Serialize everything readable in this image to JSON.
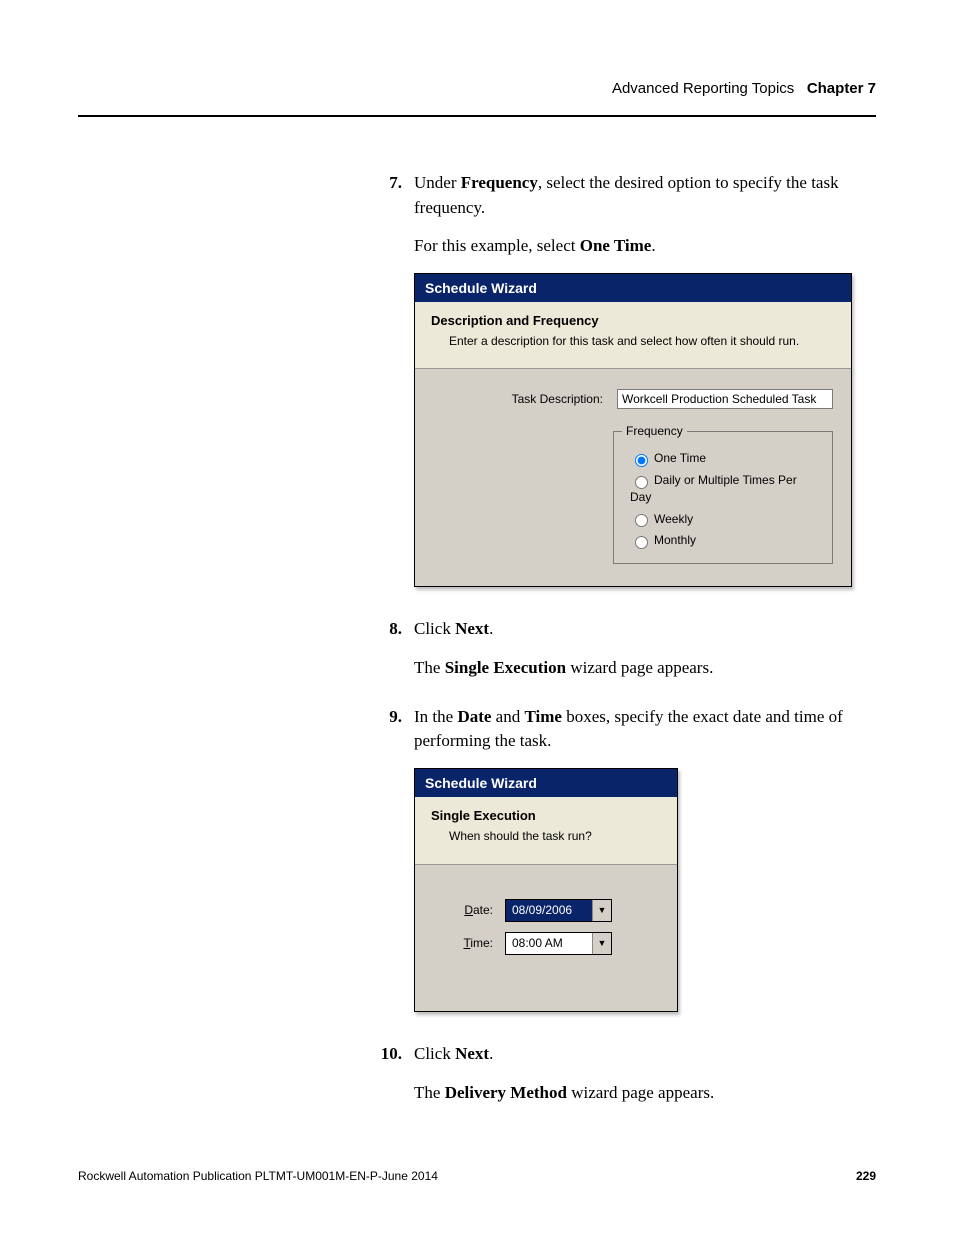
{
  "header": {
    "section": "Advanced Reporting Topics",
    "chapter": "Chapter 7"
  },
  "steps": {
    "s7": {
      "num": "7.",
      "text_pre": "Under ",
      "bold1": "Frequency",
      "text_mid": ", select the desired option to specify the task frequency.",
      "line2_pre": "For this example, select ",
      "line2_bold": "One Time",
      "line2_post": "."
    },
    "s8": {
      "num": "8.",
      "text_pre": "Click ",
      "bold1": "Next",
      "text_post": ".",
      "after_pre": "The ",
      "after_bold": "Single Execution",
      "after_post": " wizard page appears."
    },
    "s9": {
      "num": "9.",
      "text_pre": "In the ",
      "bold1": "Date",
      "text_mid": " and ",
      "bold2": "Time",
      "text_post": " boxes, specify the exact date and time of performing the task."
    },
    "s10": {
      "num": "10.",
      "text_pre": "Click ",
      "bold1": "Next",
      "text_post": ".",
      "after_pre": "The ",
      "after_bold": "Delivery Method",
      "after_post": " wizard page appears."
    }
  },
  "wizard1": {
    "title": "Schedule Wizard",
    "head_title": "Description and Frequency",
    "head_sub": "Enter a description for this task and select how often it should run.",
    "task_label": "Task Description:",
    "task_value": "Workcell Production Scheduled Task",
    "freq_legend": "Frequency",
    "opt1": "One Time",
    "opt2": "Daily or Multiple Times Per Day",
    "opt3": "Weekly",
    "opt4": "Monthly"
  },
  "wizard2": {
    "title": "Schedule Wizard",
    "head_title": "Single Execution",
    "head_sub": "When should the task run?",
    "date_label_u": "D",
    "date_label_r": "ate:",
    "date_value": "08/09/2006",
    "time_label_u": "T",
    "time_label_r": "ime:",
    "time_value": "08:00 AM"
  },
  "footer": {
    "pub": "Rockwell Automation Publication PLTMT-UM001M-EN-P-June 2014",
    "page": "229"
  }
}
